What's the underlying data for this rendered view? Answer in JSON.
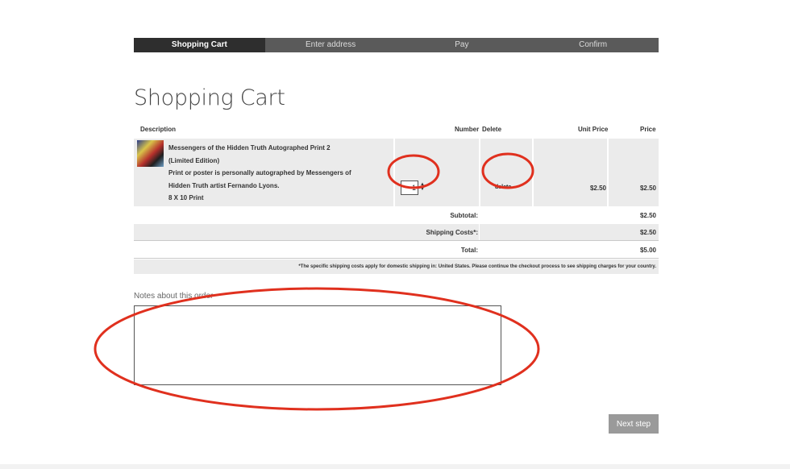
{
  "steps": [
    {
      "label": "Shopping Cart",
      "active": true
    },
    {
      "label": "Enter address",
      "active": false
    },
    {
      "label": "Pay",
      "active": false
    },
    {
      "label": "Confirm",
      "active": false
    }
  ],
  "page_title": "Shopping Cart",
  "table": {
    "headers": {
      "description": "Description",
      "number": "Number",
      "delete": "Delete",
      "unit_price": "Unit Price",
      "price": "Price"
    },
    "item": {
      "title": "Messengers of the Hidden Truth Autographed Print 2 (Limited Edition)",
      "detail": "Print or poster is personally autographed by Messengers of Hidden Truth artist Fernando Lyons.",
      "size": "8 X 10 Print",
      "quantity": "1",
      "delete_label": "delete",
      "unit_price": "$2.50",
      "price": "$2.50"
    },
    "subtotal_label": "Subtotal:",
    "subtotal": "$2.50",
    "shipping_label": "Shipping Costs*:",
    "shipping": "$2.50",
    "total_label": "Total:",
    "total": "$5.00",
    "shipping_note": "*The specific shipping costs apply for domestic shipping in: United States. Please continue the checkout process to see shipping charges for your country."
  },
  "notes": {
    "label": "Notes about this order",
    "value": ""
  },
  "next_button": "Next step",
  "colors": {
    "active_step": "#2e2e2e",
    "step_bar": "#5a5a5a",
    "row_shade": "#ebebeb",
    "annotation": "#e0301e",
    "next_button": "#9a9a9a"
  }
}
